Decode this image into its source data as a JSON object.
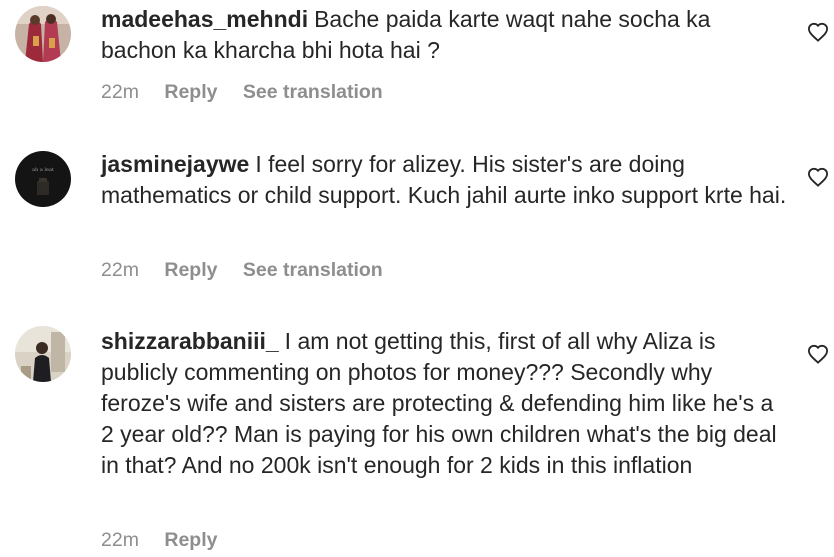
{
  "comments": [
    {
      "username": "madeehas_mehndi",
      "text": "Bache paida karte waqt nahe socha ka bachon ka kharcha bhi hota hai ?",
      "time": "22m",
      "reply_label": "Reply",
      "translate_label": "See translation"
    },
    {
      "username": "jasminejaywe",
      "text": "I feel sorry for alizey. His sister's are doing mathematics or child support. Kuch jahil aurte inko support krte hai.",
      "time": "22m",
      "reply_label": "Reply",
      "translate_label": "See translation"
    },
    {
      "username": "shizzarabbaniii_",
      "text": "I am not getting this, first of all why Aliza is publicly commenting on photos for money??? Secondly why feroze's wife and sisters are protecting & defending him like he's a 2 year old?? Man is paying for his own children what's the big deal in that? And no 200k isn't enough for 2 kids in this inflation",
      "time": "22m",
      "reply_label": "Reply"
    }
  ],
  "icons": {
    "like": "heart-outline-icon",
    "avatar": "user-avatar"
  },
  "colors": {
    "text": "#262626",
    "meta": "#8e8e8e",
    "background": "#ffffff"
  }
}
